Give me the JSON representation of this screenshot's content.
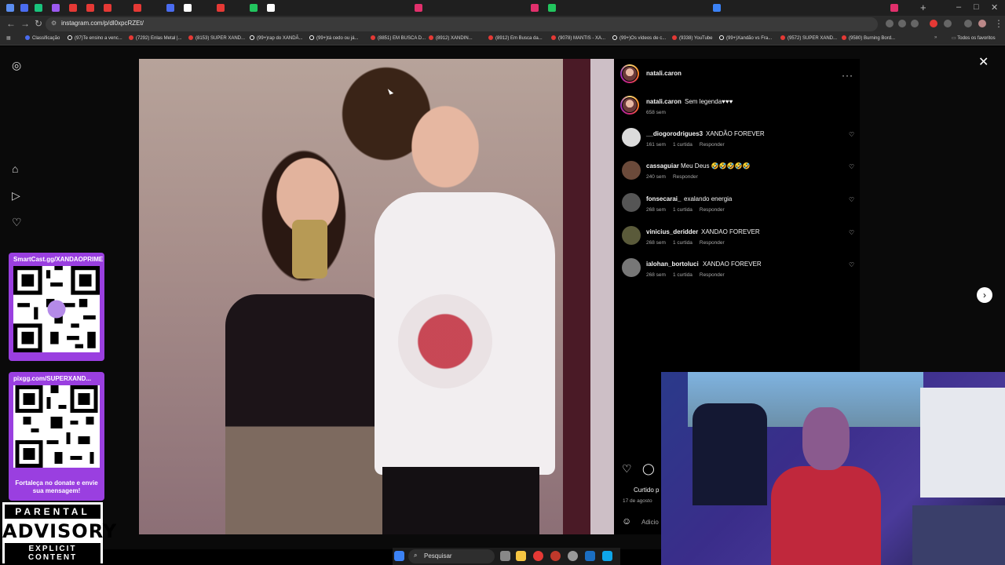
{
  "browser": {
    "url": "instagram.com/p/dl0xpcRZEt/",
    "bookmarks": [
      "Classificação",
      "(97)Te ensino a venc...",
      "(7292) Enlas Metal |...",
      "(8153) SUPER XAND...",
      "(99+)rap do XANDÃ...",
      "(99+)tá cedo ou já...",
      "(8851) EM BUSCA D...",
      "(8912) XANDIN...",
      "(8912) Em Busca da...",
      "(9078) MANTIS - XA...",
      "(99+)Os vídeos de c...",
      "(9338) YouTube",
      "(99+)Xandão vs Fra...",
      "(9572) SUPER XAND...",
      "(9580) Burning Bord..."
    ],
    "all_favorites": "Todos os favoritos"
  },
  "post": {
    "author": "natali.caron",
    "caption_author": "natali.caron",
    "caption_text": "Sem legenda♥♥♥",
    "caption_time": "658 sem",
    "comments": [
      {
        "user": "__diogorodrigues3",
        "text": "XANDÃO FOREVER",
        "time": "161 sem",
        "likes": "1 curtida",
        "reply": "Responder"
      },
      {
        "user": "cassaguiar",
        "text": "Meu Deus 🤣🤣🤣🤣🤣",
        "time": "240 sem",
        "likes": "",
        "reply": "Responder"
      },
      {
        "user": "fonsecarai_",
        "text": "exalando energia",
        "time": "268 sem",
        "likes": "1 curtida",
        "reply": "Responder"
      },
      {
        "user": "vinicius_deridder",
        "text": "XANDAO FOREVER",
        "time": "268 sem",
        "likes": "1 curtida",
        "reply": "Responder"
      },
      {
        "user": "ialohan_bortoluci",
        "text": "XANDAO FOREVER",
        "time": "268 sem",
        "likes": "1 curtida",
        "reply": "Responder"
      }
    ],
    "liked_by": "Curtido p",
    "date": "17 de agosto",
    "add_comment_placeholder": "Adicio"
  },
  "overlay": {
    "qr1_label": "SmartCast.gg/XANDAOPRIME",
    "qr2_label": "pixgg.com/SUPERXAND...",
    "qr2_sub": "Fortaleça no donate e envie sua mensagem!",
    "advisory_top": "PARENTAL",
    "advisory_mid": "ADVISORY",
    "advisory_bottom": "EXPLICIT CONTENT"
  },
  "taskbar": {
    "search": "Pesquisar"
  }
}
